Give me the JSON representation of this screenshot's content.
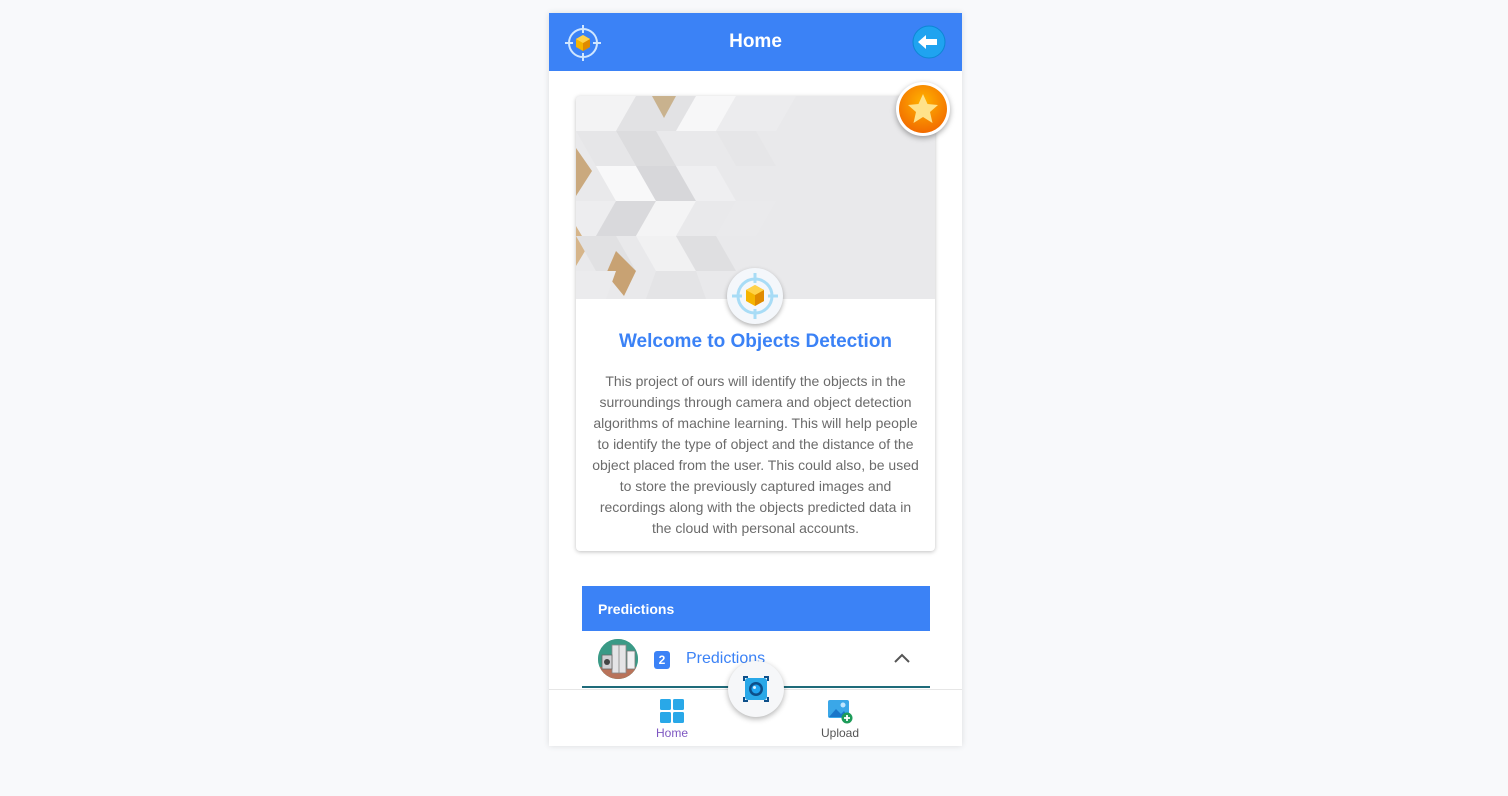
{
  "appbar": {
    "title": "Home",
    "logo_icon": "object-detection-logo-icon",
    "back_icon": "back-arrow-icon"
  },
  "card": {
    "title": "Welcome to Objects Detection",
    "body": "This project of ours will identify the objects in the surroundings through camera and object detection algorithms of machine learning. This will help people to identify the type of object and the distance of the object placed from the user. This could also, be used to store the previously captured images and recordings along with the objects predicted data in the cloud with personal accounts.",
    "star_icon": "star-badge-icon"
  },
  "predictions": {
    "header": "Predictions",
    "count": "2",
    "label": "Predictions",
    "expand_icon": "chevron-up-icon"
  },
  "bottom_nav": {
    "home_label": "Home",
    "upload_label": "Upload",
    "camera_icon": "camera-icon"
  },
  "colors": {
    "primary": "#3b82f6",
    "active_nav": "#7e57c2",
    "star": "#f59e0b"
  }
}
